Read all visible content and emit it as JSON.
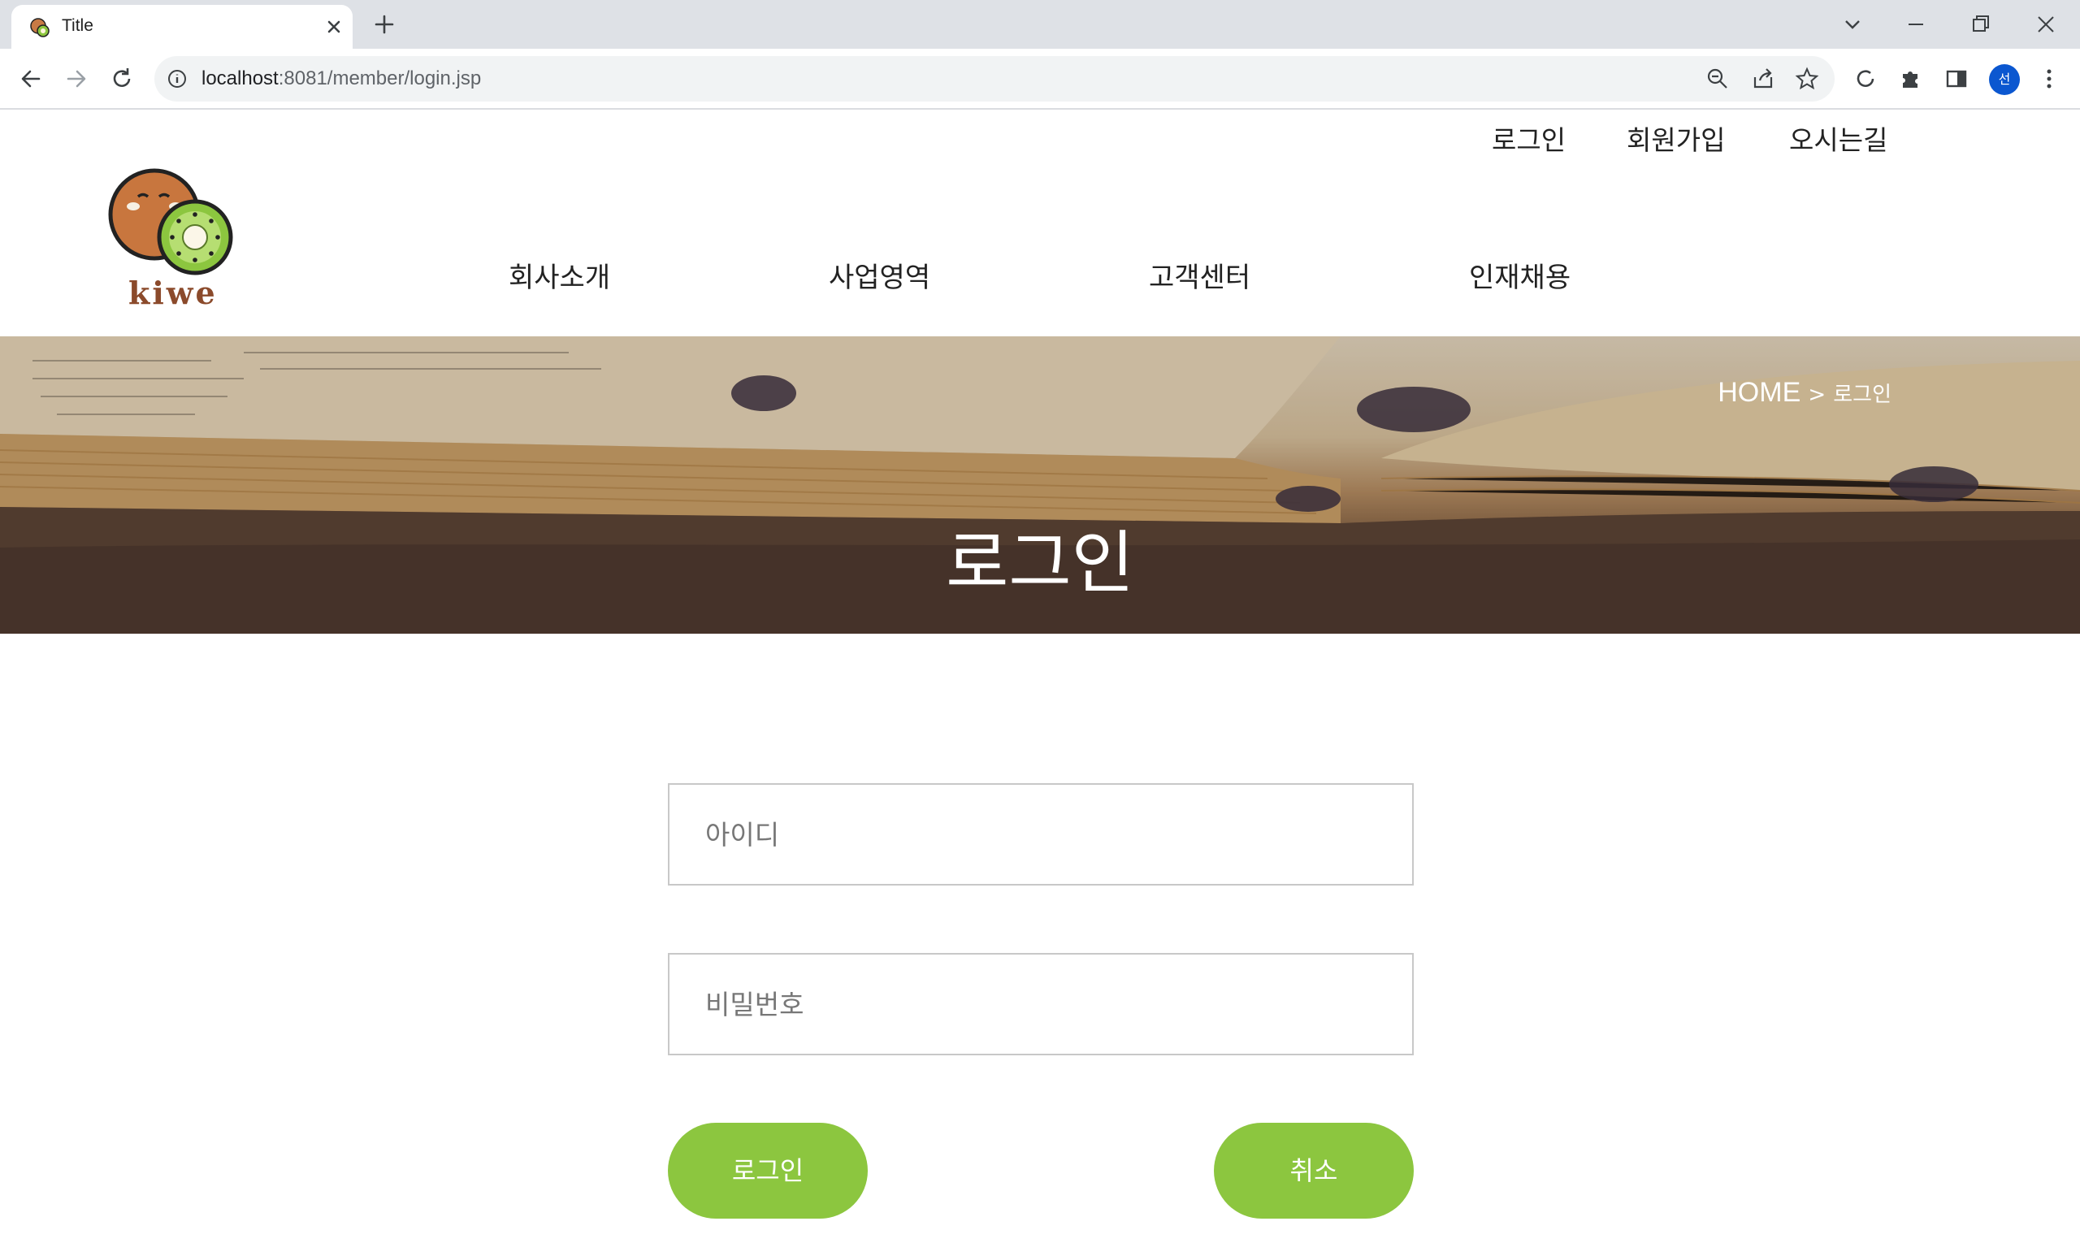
{
  "browser": {
    "tab_title": "Title",
    "url_host": "localhost",
    "url_path": ":8081/member/login.jsp",
    "profile_initial": "선"
  },
  "header": {
    "util_links": [
      "로그인",
      "회원가입",
      "오시는길"
    ],
    "logo_text": "kiwe",
    "gnb": [
      "회사소개",
      "사업영역",
      "고객센터",
      "인재채용"
    ]
  },
  "hero": {
    "breadcrumb_home": "HOME",
    "breadcrumb_sep": ">",
    "breadcrumb_current": "로그인",
    "title": "로그인"
  },
  "form": {
    "id_placeholder": "아이디",
    "pw_placeholder": "비밀번호",
    "login_label": "로그인",
    "cancel_label": "취소"
  },
  "colors": {
    "accent": "#8cc63f",
    "chrome_bg": "#dee1e6",
    "profile": "#0b57d0"
  }
}
